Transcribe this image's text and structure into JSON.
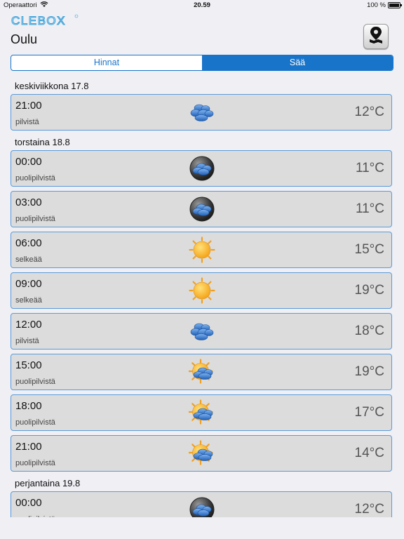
{
  "status_bar": {
    "carrier": "Operaattori",
    "time": "20.59",
    "battery": "100 %"
  },
  "header": {
    "logo_text": "CLEBOX",
    "city": "Oulu"
  },
  "tabs": [
    {
      "label": "Hinnat",
      "active": false
    },
    {
      "label": "Sää",
      "active": true
    }
  ],
  "colors": {
    "accent": "#1874c9",
    "card_bg": "#dcdcdc",
    "card_border": "#5b9bd9"
  },
  "forecast": [
    {
      "day": "keskiviikkona 17.8",
      "items": [
        {
          "time": "21:00",
          "desc": "pilvistä",
          "icon": "cloudy-icon",
          "temp": "12°C"
        }
      ]
    },
    {
      "day": "torstaina 18.8",
      "items": [
        {
          "time": "00:00",
          "desc": "puolipilvistä",
          "icon": "night-partly-cloudy-icon",
          "temp": "11°C"
        },
        {
          "time": "03:00",
          "desc": "puolipilvistä",
          "icon": "night-partly-cloudy-icon",
          "temp": "11°C"
        },
        {
          "time": "06:00",
          "desc": "selkeää",
          "icon": "sun-icon",
          "temp": "15°C"
        },
        {
          "time": "09:00",
          "desc": "selkeää",
          "icon": "sun-icon",
          "temp": "19°C"
        },
        {
          "time": "12:00",
          "desc": "pilvistä",
          "icon": "cloudy-icon",
          "temp": "18°C"
        },
        {
          "time": "15:00",
          "desc": "puolipilvistä",
          "icon": "partly-cloudy-icon",
          "temp": "19°C"
        },
        {
          "time": "18:00",
          "desc": "puolipilvistä",
          "icon": "partly-cloudy-icon",
          "temp": "17°C"
        },
        {
          "time": "21:00",
          "desc": "puolipilvistä",
          "icon": "partly-cloudy-icon",
          "temp": "14°C"
        }
      ]
    },
    {
      "day": "perjantaina 19.8",
      "items": [
        {
          "time": "00:00",
          "desc": "puolipilvistä",
          "icon": "night-partly-cloudy-icon",
          "temp": "12°C"
        }
      ]
    }
  ]
}
